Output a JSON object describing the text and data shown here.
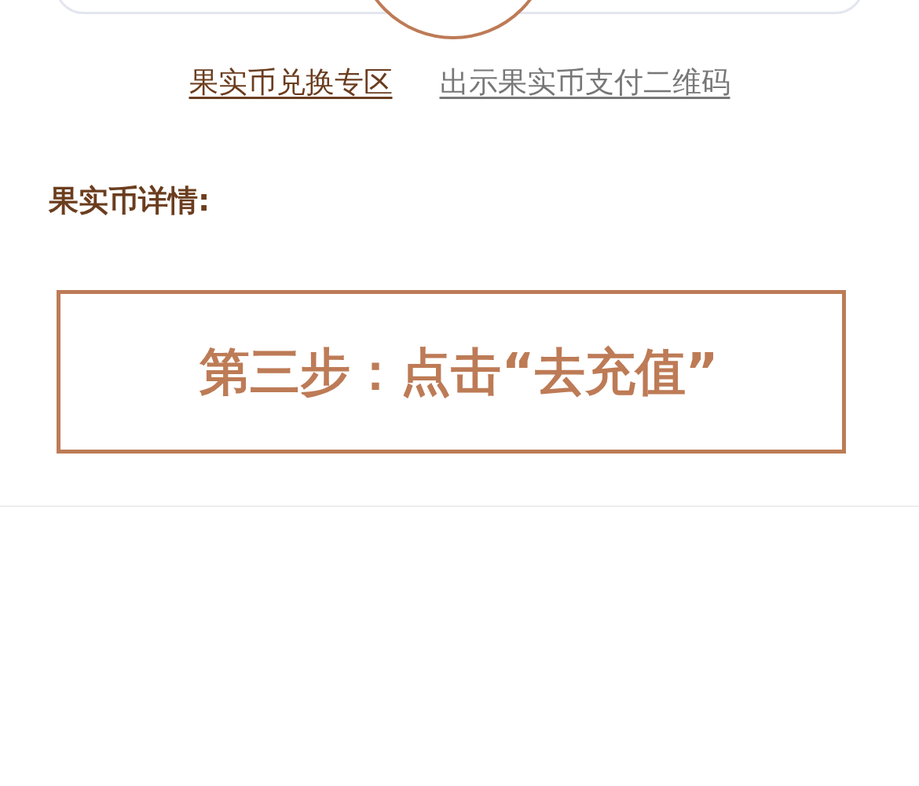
{
  "links": [
    {
      "label": "果实币兑换专区",
      "selected": true
    },
    {
      "label": "出示果实币支付二维码",
      "selected": false
    }
  ],
  "details_heading": "果实币详情:",
  "step_banner": {
    "text": "第三步：点击“去充值”"
  }
}
